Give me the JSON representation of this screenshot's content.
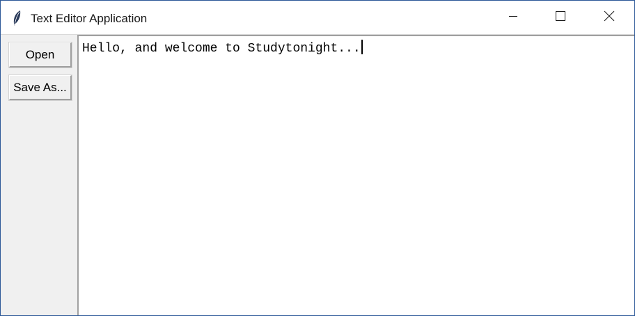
{
  "window": {
    "title": "Text Editor Application"
  },
  "sidebar": {
    "open_label": "Open",
    "save_as_label": "Save As..."
  },
  "editor": {
    "content": "Hello, and welcome to Studytonight..."
  },
  "icons": {
    "app": "feather-icon",
    "minimize": "minimize-icon",
    "maximize": "maximize-icon",
    "close": "close-icon"
  },
  "colors": {
    "window_border": "#2b5797",
    "panel_bg": "#f0f0f0",
    "editor_bg": "#ffffff"
  }
}
